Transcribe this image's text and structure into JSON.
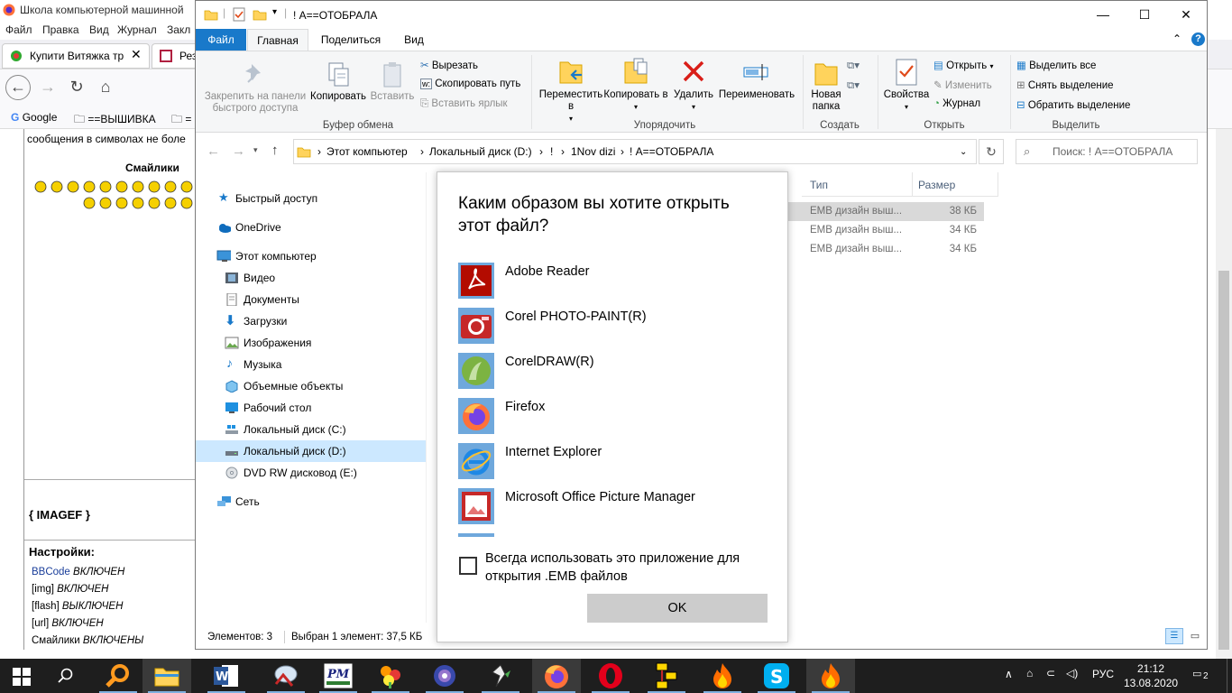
{
  "browser": {
    "title": "Школа компьютерной машинной",
    "menu": [
      "Файл",
      "Правка",
      "Вид",
      "Журнал",
      "Закл"
    ],
    "tabs": [
      "Купити Витяжка тр",
      "Рез"
    ],
    "bookmarks": [
      "Google",
      "==ВЫШИВКА",
      "="
    ],
    "page": {
      "message_snippet": "сообщения в символах не боле",
      "smilies_heading": "Смайлики",
      "imagef": "{ IMAGEF }",
      "settings_heading": "Настройки:",
      "settings": [
        {
          "key": "BBCode",
          "value": "ВКЛЮЧЕН"
        },
        {
          "key": "[img]",
          "value": "ВКЛЮЧЕН"
        },
        {
          "key": "[flash]",
          "value": "ВЫКЛЮЧЕН"
        },
        {
          "key": "[url]",
          "value": "ВКЛЮЧЕН"
        },
        {
          "key": "Смайлики",
          "value": "ВКЛЮЧЕНЫ"
        }
      ]
    }
  },
  "explorer": {
    "title": "! А==ОТОБРАЛА",
    "ribbon_tabs": {
      "file": "Файл",
      "home": "Главная",
      "share": "Поделиться",
      "view": "Вид"
    },
    "ribbon": {
      "pin": "Закрепить на панели быстрого доступа",
      "copy": "Копировать",
      "paste": "Вставить",
      "cut": "Вырезать",
      "copy_path": "Скопировать путь",
      "paste_shortcut": "Вставить ярлык",
      "clipboard_group": "Буфер обмена",
      "move_to": "Переместить в",
      "copy_to": "Копировать в",
      "delete": "Удалить",
      "rename": "Переименовать",
      "organize_group": "Упорядочить",
      "new_folder": "Новая папка",
      "create_group": "Создать",
      "properties": "Свойства",
      "open": "Открыть",
      "edit": "Изменить",
      "history": "Журнал",
      "open_group": "Открыть",
      "select_all": "Выделить все",
      "select_none": "Снять выделение",
      "invert_selection": "Обратить выделение",
      "select_group": "Выделить"
    },
    "breadcrumb": [
      "Этот компьютер",
      "Локальный диск (D:)",
      "!",
      "1Nov dizi",
      "! А==ОТОБРАЛА"
    ],
    "search_placeholder": "Поиск: ! А==ОТОБРАЛА",
    "nav": {
      "quick_access": "Быстрый доступ",
      "onedrive": "OneDrive",
      "this_pc": "Этот компьютер",
      "video": "Видео",
      "documents": "Документы",
      "downloads": "Загрузки",
      "pictures": "Изображения",
      "music": "Музыка",
      "objects3d": "Объемные объекты",
      "desktop": "Рабочий стол",
      "disk_c": "Локальный диск (C:)",
      "disk_d": "Локальный диск (D:)",
      "dvd": "DVD RW дисковод (E:)",
      "network": "Сеть"
    },
    "columns": {
      "type": "Тип",
      "size": "Размер"
    },
    "files": [
      {
        "type": "EMB дизайн выш...",
        "size": "38 КБ"
      },
      {
        "type": "EMB дизайн выш...",
        "size": "34 КБ"
      },
      {
        "type": "EMB дизайн выш...",
        "size": "34 КБ"
      }
    ],
    "status": {
      "count": "Элементов: 3",
      "selected": "Выбран 1 элемент: 37,5 КБ"
    }
  },
  "dialog": {
    "title": "Каким образом вы хотите открыть этот файл?",
    "apps": [
      "Adobe Reader",
      "Corel PHOTO-PAINT(R)",
      "CorelDRAW(R)",
      "Firefox",
      "Internet Explorer",
      "Microsoft Office Picture Manager"
    ],
    "always_use": "Всегда использовать это приложение для открытия .EMB файлов",
    "ok": "OK"
  },
  "taskbar": {
    "lang": "РУС",
    "time": "21:12",
    "date": "13.08.2020",
    "notifications": "2",
    "items": [
      "start-icon",
      "search-icon",
      "file-explorer-icon",
      "word-icon",
      "embird-icon",
      "pm-icon",
      "flowers-icon",
      "flower-icon",
      "inkscape-icon",
      "firefox-icon",
      "opera-icon",
      "chart-icon",
      "fire-icon",
      "skype-icon",
      "fire-icon-2"
    ]
  },
  "colors": {
    "accent": "#1979ca",
    "selection": "#cce8ff",
    "taskbar": "#1e1e1e"
  }
}
